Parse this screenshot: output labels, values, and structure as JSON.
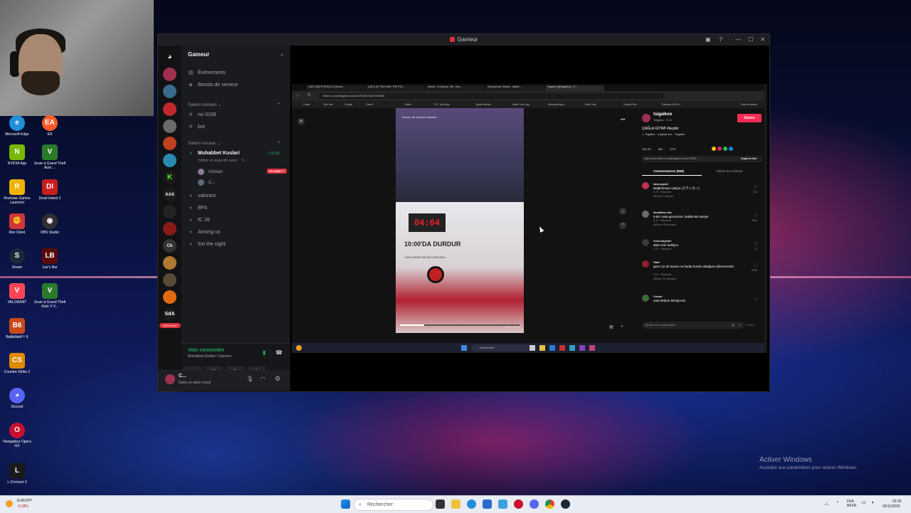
{
  "desktop": {
    "icons": [
      {
        "label": "Microsoft Edge",
        "color": "#1f8fd8"
      },
      {
        "label": "EA",
        "color": "#ff5a28"
      },
      {
        "label": "NVIDIA App",
        "color": "#76b900"
      },
      {
        "label": "Jouer à Grand Theft Auto ...",
        "color": "#2a7a2a"
      },
      {
        "label": "Rockstar Games Launcher",
        "color": "#f0b400"
      },
      {
        "label": "Dead Island 2",
        "color": "#c81e1e"
      },
      {
        "label": "Riot Client",
        "color": "#d13639"
      },
      {
        "label": "OBS Studio",
        "color": "#302e31"
      },
      {
        "label": "Steam",
        "color": "#1b2838"
      },
      {
        "label": "Liar's Bar",
        "color": "#5a0a0a"
      },
      {
        "label": "VALORANT",
        "color": "#ff4655"
      },
      {
        "label": "Jouer à Grand Theft Auto V V...",
        "color": "#2a7a2a"
      },
      {
        "label": "Battlefield™ 6",
        "color": "#c84a1a"
      },
      {
        "label": "Counter-Strike 2",
        "color": "#e08a00"
      },
      {
        "label": "Discord",
        "color": "#5865f2"
      },
      {
        "label": "Navigateur Opera GX",
        "color": "#c8102e"
      },
      {
        "label": "L-Connect 3",
        "color": "#1a1a1a"
      }
    ],
    "activate": {
      "title": "Activer Windows",
      "subtitle": "Accédez aux paramètres pour activer Windows."
    }
  },
  "discord": {
    "window_title": "Gameur",
    "server_name": "Gameur",
    "top_items": [
      {
        "icon": "calendar-icon",
        "label": "Événements"
      },
      {
        "icon": "boost-icon",
        "label": "Boosts de serveur"
      }
    ],
    "text_category": "Salons textuels",
    "text_channels": [
      "no-3169",
      "bot"
    ],
    "voice_category": "Salons vocaux",
    "active_voice": {
      "name": "Muhabbet Kuslari",
      "time": "3:32:55",
      "status_hint": "Définir un statut de salon",
      "members": [
        {
          "name": "Görkan",
          "badge": "EN DIRECT"
        },
        {
          "name": "C..."
        }
      ]
    },
    "voice_channels": [
      "valorant",
      "BF6",
      "fC 26",
      "Among us",
      "fort the night"
    ],
    "guild_badges": {
      "nouveau": "NOUVEAU",
      "aax": "AAX",
      "sda": "SdA",
      "ch": "Ch"
    },
    "voice_status": {
      "title": "Voix connectée",
      "sub": "Muhabbet Kuslari / Gameur"
    },
    "user": {
      "name": "C...",
      "status": "Dans un salon vocal"
    }
  },
  "share": {
    "tabs": [
      "(1827) BATTLEFIELD 6 (Nover...",
      "(1827) BZ TWO-WAY TRETRO ...",
      "Naruto - 6 Episode 149 - Nov...",
      "ScrimpChan Stream - Watch ...",
      "Tsigalko (@tsigalkoo) | Ti..."
    ],
    "url": "tiktok.com/@tsigalkoo/video/7552573837098058",
    "bookmarks": [
      "Gmail",
      "YouTube",
      "Google",
      "Twitch",
      "Twitter",
      "FUT Web App",
      "Squad Builder",
      "Make Your Day",
      "Minecraft Apps",
      "Uber Eats",
      "Disney Plus",
      "Faktoidy v25.1.4",
      "Tous les favoris"
    ],
    "video": {
      "search": "Trouver du contenu associé",
      "countdown": "04:04",
      "overlay_text": "10:00'DA DURDUR",
      "small_text": "TÜM ALPEREN BEYİNİ DURDURDU",
      "time": "00:06 / 00:20",
      "progress": 0.2
    },
    "creator": {
      "handle": "tsigalkoo",
      "name": "Tsigalko · 9-21",
      "follow": "Suivre",
      "caption": "ÇAĞLA GİYİM! #keşfet",
      "sound": "♫ Tsigalko - original ses - Tsigalko",
      "link": "https://www.tiktok.com/@tsigalkoo/video/75525...",
      "copy": "Copier le lien",
      "tab_comments": "Commentaires (859)",
      "tab_videos": "Vidéos du créateur",
      "stats": [
        "150.9K",
        "859",
        "6767"
      ]
    },
    "comments": [
      {
        "name": "tana.yayo3",
        "text": "Beğenmeye çalışın (スティカー)",
        "meta": "9-26 · Répondre",
        "replies": "Afficher 1 réponse",
        "likes": "181"
      },
      {
        "name": "Nostilhan Ata",
        "text": "9.95 i asla geremicez dakika 60 saniye",
        "meta": "9-22 · Répondre",
        "replies": "Afficher 45 réponses",
        "likes": "3506"
      },
      {
        "name": "fuvol.kayeber",
        "text": "abim enir bekliyor",
        "meta": "9-21 · Répondre",
        "replies": "",
        "likes": "17"
      },
      {
        "name": "Hilal",
        "text": "gece 12 de bunun ne kadar komik olduğunu bilemessiniz",
        "meta": "9-21 · Répondre",
        "replies": "Afficher 24 réponses",
        "likes": "5350"
      },
      {
        "name": "Cumul",
        "text": "saat 90dam bilmiyordu",
        "meta": "",
        "replies": "",
        "likes": ""
      }
    ],
    "add_comment": "Ajouter un commentaire...",
    "post": "Publier",
    "inner_taskbar_search": "Rechercher"
  },
  "taskbar": {
    "weather": {
      "label": "EUR/JPY",
      "value": "-0,28%"
    },
    "search_placeholder": "Rechercher",
    "lang": "FRA\nBEFR",
    "clock_time": "03:35",
    "clock_date": "05/11/2025"
  },
  "colors": {
    "discord_bg": "#111214",
    "channel_bg": "#1a1b1e",
    "live_red": "#e0303a",
    "tiktok_pink": "#fe2c55",
    "voice_green": "#23a55a"
  }
}
